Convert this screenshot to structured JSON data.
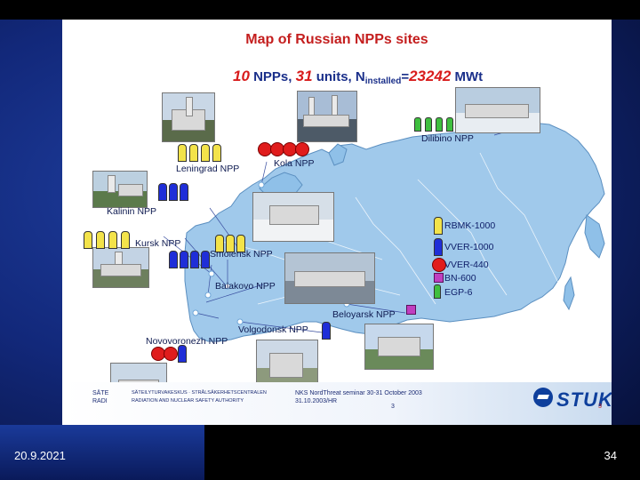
{
  "slide": {
    "title": "Map of Russian NPPs sites",
    "stats": {
      "npps_value": "10",
      "npps_label": "NPPs,",
      "units_value": "31",
      "units_label": "units,",
      "n_label": "N",
      "n_sub": "installed",
      "equals": "=",
      "power_value": "23242",
      "power_unit": "MWt"
    },
    "sites": [
      {
        "name": "Leningrad NPP"
      },
      {
        "name": "Kola NPP"
      },
      {
        "name": "Dilibino NPP"
      },
      {
        "name": "Kalinin NPP"
      },
      {
        "name": "Kursk NPP"
      },
      {
        "name": "Smolensk NPP"
      },
      {
        "name": "Balakovo NPP"
      },
      {
        "name": "Beloyarsk NPP"
      },
      {
        "name": "Volgodonsk NPP"
      },
      {
        "name": "Novovoronezh NPP"
      }
    ],
    "legend": [
      {
        "label": "RBMK-1000",
        "color": "#f3e34a"
      },
      {
        "label": "VVER-1000",
        "color": "#1f2ed8"
      },
      {
        "label": "VVER-440",
        "color": "#e01c1c"
      },
      {
        "label": "BN-600",
        "color": "#c03ec0"
      },
      {
        "label": "EGP-6",
        "color": "#3fbf3f"
      }
    ],
    "inner_footer": {
      "left_line1": "SÄTE",
      "left_line2": "RADI",
      "mid_line1": "SÄTEILYTURVAKESKUS · STRÅLSÄKERHETSCENTRALEN",
      "mid_line2": "RADIATION AND NUCLEAR SAFETY AUTHORITY",
      "event_line1": "NKS NordThreat seminar 30-31 October 2003",
      "event_line2": "31.10.2003/HR",
      "page": "3",
      "logo": "STUK",
      "corner_num": "3"
    }
  },
  "footer": {
    "date": "20.9.2021",
    "page": "34"
  },
  "colors": {
    "title": "#c41e1e",
    "accent_red": "#d81c1c",
    "navy_text": "#1a2f8a",
    "map_fill": "#8fc0e8"
  }
}
